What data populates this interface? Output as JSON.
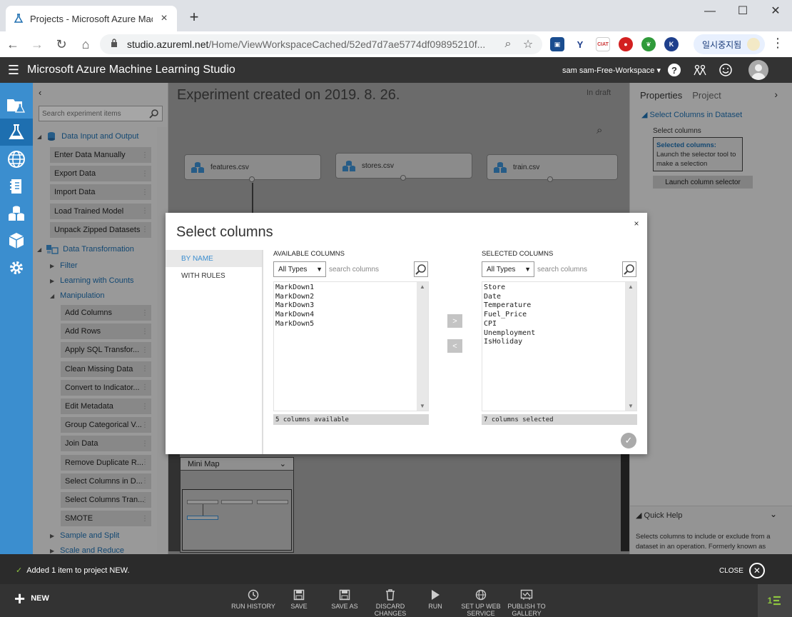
{
  "browser": {
    "tab_title": "Projects - Microsoft Azure Mach",
    "url_host": "studio.azureml.net",
    "url_path": "/Home/ViewWorkspaceCached/52ed7d7ae5774df09895210f...",
    "profile_label": "일시중지됨"
  },
  "app": {
    "title": "Microsoft Azure Machine Learning Studio",
    "workspace": "sam sam-Free-Workspace",
    "workspace_caret": "▾"
  },
  "palette": {
    "search_placeholder": "Search experiment items",
    "groups": {
      "data_io": "Data Input and Output",
      "data_transform": "Data Transformation"
    },
    "data_io_items": [
      "Enter Data Manually",
      "Export Data",
      "Import Data",
      "Load Trained Model",
      "Unpack Zipped Datasets"
    ],
    "subgroups": {
      "filter": "Filter",
      "learning": "Learning with Counts",
      "manipulation": "Manipulation",
      "sample": "Sample and Split",
      "scale": "Scale and Reduce"
    },
    "manipulation_items": [
      "Add Columns",
      "Add Rows",
      "Apply SQL Transfor...",
      "Clean Missing Data",
      "Convert to Indicator...",
      "Edit Metadata",
      "Group Categorical V...",
      "Join Data",
      "Remove Duplicate R...",
      "Select Columns in D...",
      "Select Columns Tran...",
      "SMOTE"
    ]
  },
  "canvas": {
    "title": "Experiment created on 2019. 8. 26.",
    "status": "In draft",
    "nodes": [
      "features.csv",
      "stores.csv",
      "train.csv"
    ],
    "minimap_label": "Mini Map"
  },
  "properties": {
    "tab_properties": "Properties",
    "tab_project": "Project",
    "section": "Select Columns in Dataset",
    "field_label": "Select columns",
    "box_title": "Selected columns:",
    "box_text": "Launch the selector tool to make a selection",
    "launch_button": "Launch column selector",
    "quick_help_title": "Quick Help",
    "quick_help_text": "Selects columns to include or exclude from a dataset in an operation. Formerly known as"
  },
  "modal": {
    "title": "Select columns",
    "close": "×",
    "tab_by_name": "BY NAME",
    "tab_with_rules": "WITH RULES",
    "available_header": "AVAILABLE COLUMNS",
    "selected_header": "SELECTED COLUMNS",
    "type_filter": "All Types",
    "search_placeholder": "search columns",
    "available": [
      "MarkDown1",
      "MarkDown2",
      "MarkDown3",
      "MarkDown4",
      "MarkDown5"
    ],
    "selected": [
      "Store",
      "Date",
      "Temperature",
      "Fuel_Price",
      "CPI",
      "Unemployment",
      "IsHoliday"
    ],
    "available_count": "5 columns available",
    "selected_count": "7 columns selected",
    "move_right": ">",
    "move_left": "<"
  },
  "notification": {
    "text": "Added 1 item to project NEW.",
    "close_label": "CLOSE"
  },
  "commands": {
    "new": "NEW",
    "run_history": "RUN HISTORY",
    "save": "SAVE",
    "save_as": "SAVE AS",
    "discard": "DISCARD CHANGES",
    "run": "RUN",
    "setup_web": "SET UP WEB SERVICE",
    "publish": "PUBLISH TO GALLERY",
    "right_badge": "1"
  }
}
